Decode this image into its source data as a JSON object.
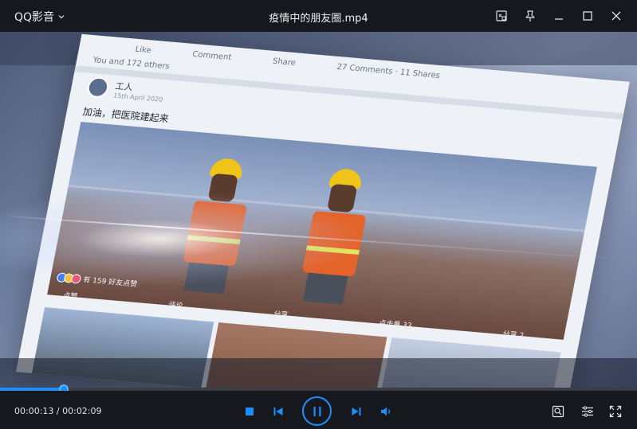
{
  "app": {
    "brand": "QQ影音",
    "window_title": "疫情中的朋友圈.mp4"
  },
  "colors": {
    "accent": "#1a8fff",
    "titlebar_bg": "#16181d",
    "text": "#dfe3ea"
  },
  "video_frame": {
    "top_row": [
      "Like",
      "Comment",
      "Share",
      "27 Comments · 11 Shares"
    ],
    "top_meta": "You and 172 others",
    "author": "工人",
    "author_date": "15th April 2020",
    "post_text": "加油，把医院建起来",
    "likes_text": "有 159 好友点赞",
    "actions": [
      "点赞",
      "评论",
      "分享",
      "点击量 33",
      "分享 2"
    ]
  },
  "player": {
    "current_time": "00:00:13",
    "separator": " / ",
    "total_time": "00:02:09",
    "progress_fraction": 0.1,
    "state": "playing"
  },
  "icons": {
    "brand_menu": "chevron-down-icon",
    "win": [
      "mini-mode-icon",
      "pin-icon",
      "minimize-icon",
      "maximize-icon",
      "close-icon"
    ],
    "controls": [
      "stop-icon",
      "previous-icon",
      "pause-icon",
      "next-icon",
      "volume-icon"
    ],
    "right_controls": [
      "screenshot-icon",
      "settings-sliders-icon",
      "fullscreen-icon"
    ]
  }
}
